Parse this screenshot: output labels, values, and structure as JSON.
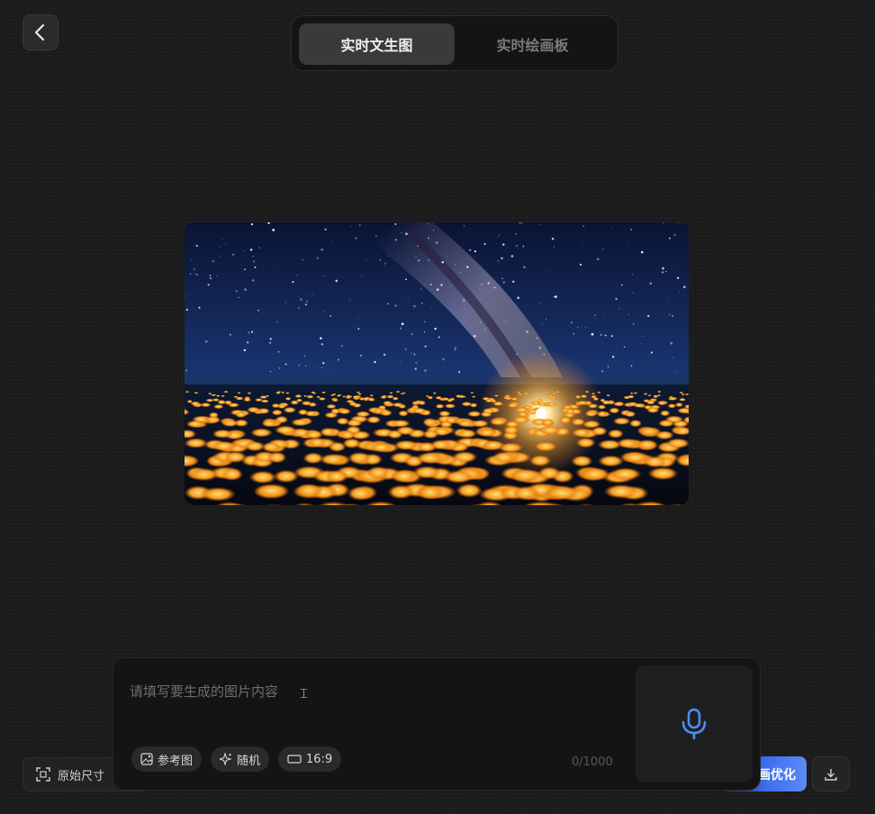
{
  "header": {
    "tabs": [
      {
        "label": "实时文生图",
        "active": true
      },
      {
        "label": "实时绘画板",
        "active": false
      }
    ]
  },
  "preview": {
    "colors": {
      "sky_top": "#0b1a3a",
      "sky_mid": "#1c3a7a",
      "glow": "#ffd36a",
      "flowers": "#f5a623"
    }
  },
  "prompt": {
    "placeholder": "请填写要生成的图片内容",
    "value": "",
    "counter": "0/1000",
    "chips": [
      {
        "icon": "reference-image-icon",
        "label": "参考图"
      },
      {
        "icon": "sparkle-icon",
        "label": "随机"
      },
      {
        "icon": "aspect-ratio-icon",
        "label": "16:9"
      }
    ]
  },
  "footer": {
    "original_size_label": "原始尺寸",
    "optimize_label": "画优化",
    "accent": "#4f80f5"
  }
}
